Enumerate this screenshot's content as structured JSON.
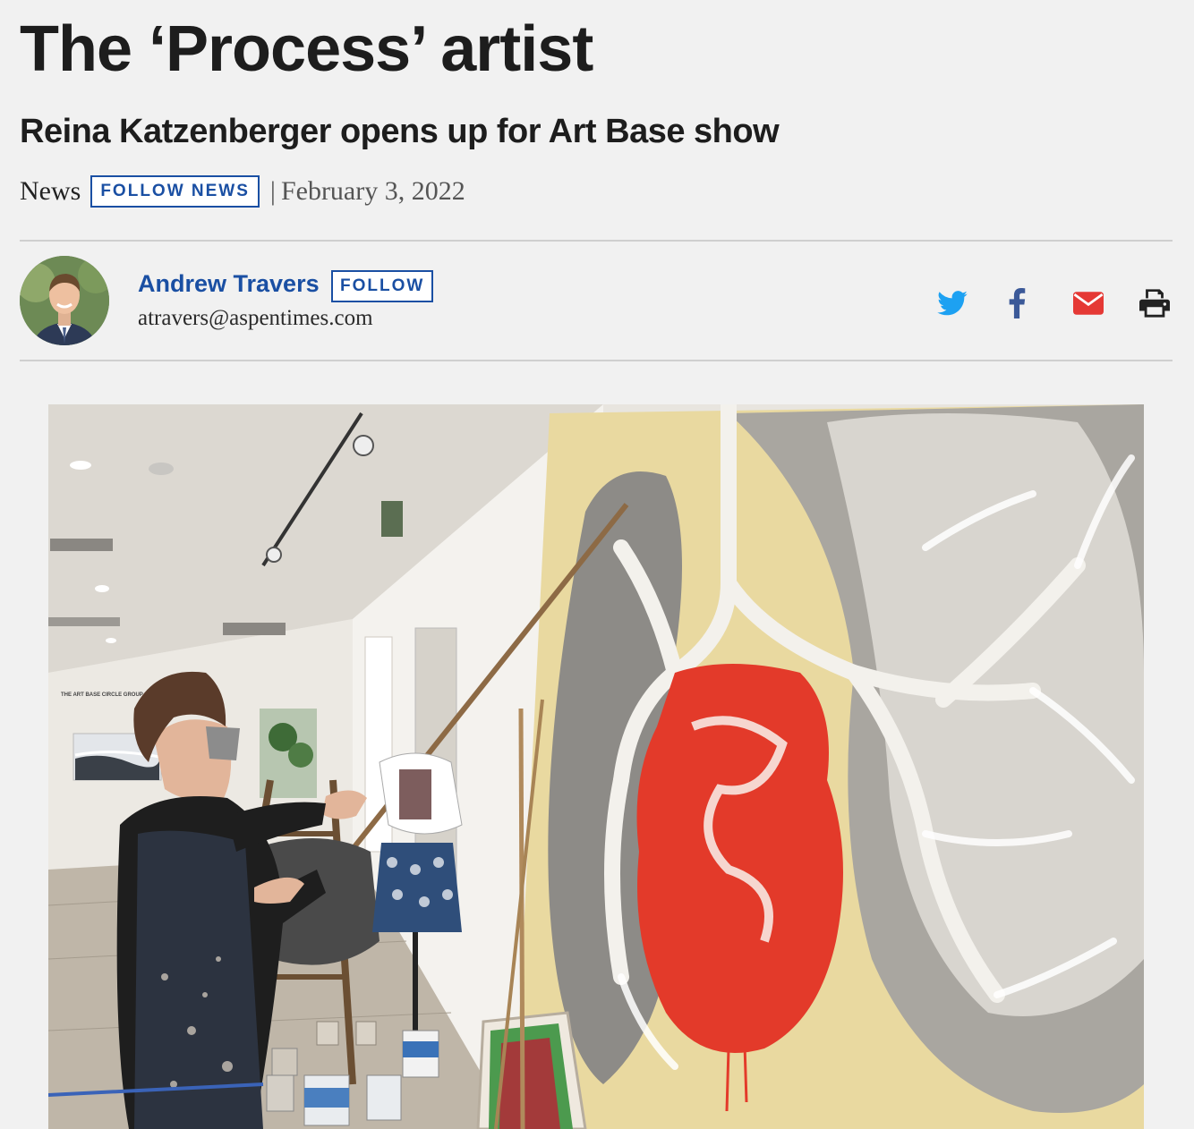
{
  "article": {
    "headline": "The ‘Process’ artist",
    "subheadline": "Reina Katzenberger opens up for Art Base show",
    "section": "News",
    "follow_section_label": "FOLLOW NEWS",
    "separator": "|",
    "date": "February 3, 2022"
  },
  "author": {
    "name": "Andrew Travers",
    "follow_label": "FOLLOW",
    "email": "atravers@aspentimes.com"
  },
  "share": {
    "icons": [
      "twitter-icon",
      "facebook-icon",
      "email-icon",
      "print-icon"
    ]
  },
  "photo": {
    "gallery_sign": "THE ART BASE CIRCLE GROUP"
  },
  "colors": {
    "link_blue": "#1a4fa3",
    "twitter": "#1da1f2",
    "facebook": "#3b5998",
    "email": "#e53935",
    "print": "#222222",
    "background": "#f1f1f1"
  }
}
